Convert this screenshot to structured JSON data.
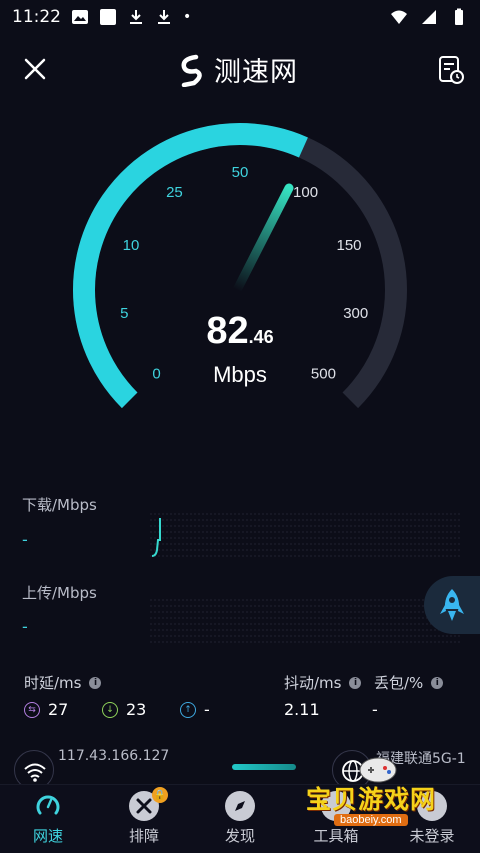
{
  "status_bar": {
    "time": "11:22"
  },
  "header": {
    "brand": "测速网"
  },
  "gauge": {
    "tick_labels": [
      "0",
      "5",
      "10",
      "25",
      "50",
      "100",
      "150",
      "300",
      "500"
    ],
    "value_int": "82",
    "value_dec": ".46",
    "unit": "Mbps",
    "progress_tick_fraction": 0.5,
    "accent": "#2ad4e0",
    "track": "#272a38"
  },
  "download": {
    "label": "下载/Mbps",
    "value": "-"
  },
  "upload": {
    "label": "上传/Mbps",
    "value": "-"
  },
  "stats": {
    "latency_label": "时延/ms",
    "jitter_label": "抖动/ms",
    "loss_label": "丢包/%",
    "ping": "27",
    "down_latency": "23",
    "up_latency": "-",
    "jitter": "2.11",
    "loss": "-"
  },
  "network": {
    "ip": "117.43.166.127",
    "isp": "福建联通5G-1"
  },
  "tabs": [
    {
      "label": "网速",
      "icon": "speedometer-icon"
    },
    {
      "label": "排障",
      "icon": "tools-icon"
    },
    {
      "label": "发现",
      "icon": "compass-icon"
    },
    {
      "label": "工具箱",
      "icon": "toolbox-icon"
    },
    {
      "label": "未登录",
      "icon": "user-icon"
    }
  ],
  "watermark": {
    "text": "宝贝游戏网",
    "url": "baobeiy.com"
  }
}
